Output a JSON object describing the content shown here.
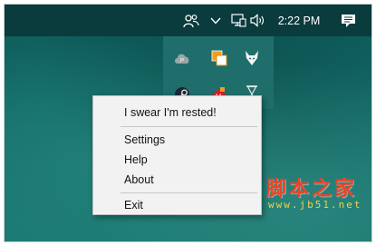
{
  "taskbar": {
    "clock": "2:22 PM",
    "icons": [
      "people-icon",
      "chevron-up-icon",
      "network-icon",
      "volume-icon",
      "notification-icon"
    ]
  },
  "tray_overflow": {
    "icons": [
      "cloud-sync-icon",
      "copy-icon",
      "wolf-icon",
      "steam-icon",
      "creative-cloud-icon",
      "hourglass-icon"
    ]
  },
  "context_menu": {
    "items": [
      {
        "label": "I swear I'm rested!"
      },
      {
        "label": "Settings"
      },
      {
        "label": "Help"
      },
      {
        "label": "About"
      },
      {
        "label": "Exit"
      }
    ]
  },
  "watermark": {
    "title": "脚本之家",
    "url": "www.jb51.net"
  },
  "colors": {
    "taskbar": "#0a3b3d",
    "tray": "#1f6e6b",
    "menu_bg": "#f2f2f2",
    "watermark_red": "#e8452a",
    "watermark_yellow": "#f0d24a"
  }
}
